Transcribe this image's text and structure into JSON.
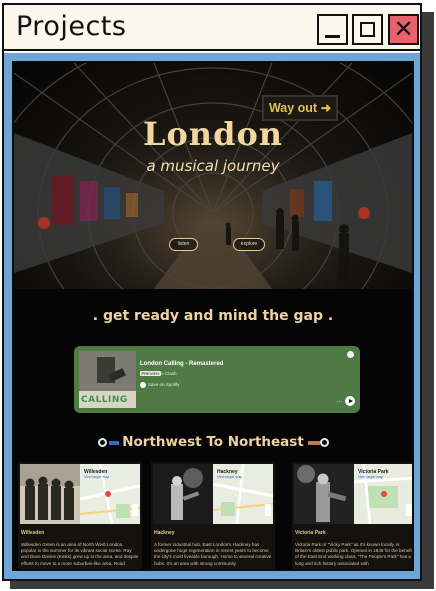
{
  "window": {
    "title": "Projects",
    "controls": {
      "minimize": "minimize-icon",
      "maximize": "maximize-icon",
      "close_glyph": "✕"
    }
  },
  "hero": {
    "title": "London",
    "subtitle": "a musical journey",
    "sign": "Way out ➜",
    "buttons": {
      "listen": "listen",
      "explore": "explore"
    }
  },
  "tagline": ". get ready and mind the gap .",
  "player": {
    "track_title": "London Calling - Remastered",
    "badge": "PREVIEW",
    "artist": "The Clash",
    "service": "Save on Spotify",
    "more": "...",
    "album_art_text": "CALLING"
  },
  "route": {
    "title": "Northwest To Northeast"
  },
  "cards": [
    {
      "name": "Willesden",
      "map_label": "Willesden",
      "map_link": "View larger map",
      "description": "Willesden Green is an area of North West London, popular in the summer for its vibrant social scene. Ray and Dave Davies (Kinks) grew up in the area, and despite efforts to move to a more suburban-like area, Road"
    },
    {
      "name": "Hackney",
      "map_label": "Hackney",
      "map_link": "View larger map",
      "description": "A former industrial hub, East London's Hackney has undergone huge regeneration in recent years to become the city's most liveable borough. Home to several creative hubs. It's an area with strong community"
    },
    {
      "name": "Victoria Park",
      "map_label": "Victoria Park",
      "map_link": "View larger map",
      "description": "Victoria Park or \"Vicky Park\" as it's known locally, is Britain's oldest public park. Opened in 1845 for the benefit of the East End working class, \"The People's Park\" has a long and rich history associated with"
    }
  ],
  "colors": {
    "frame": "#6fa4d6",
    "accent_gold": "#ecd3a6",
    "player_green": "#4f7a44",
    "close_red": "#e8626b",
    "route_left": "#2f6fbf",
    "route_right": "#b87d4b"
  }
}
